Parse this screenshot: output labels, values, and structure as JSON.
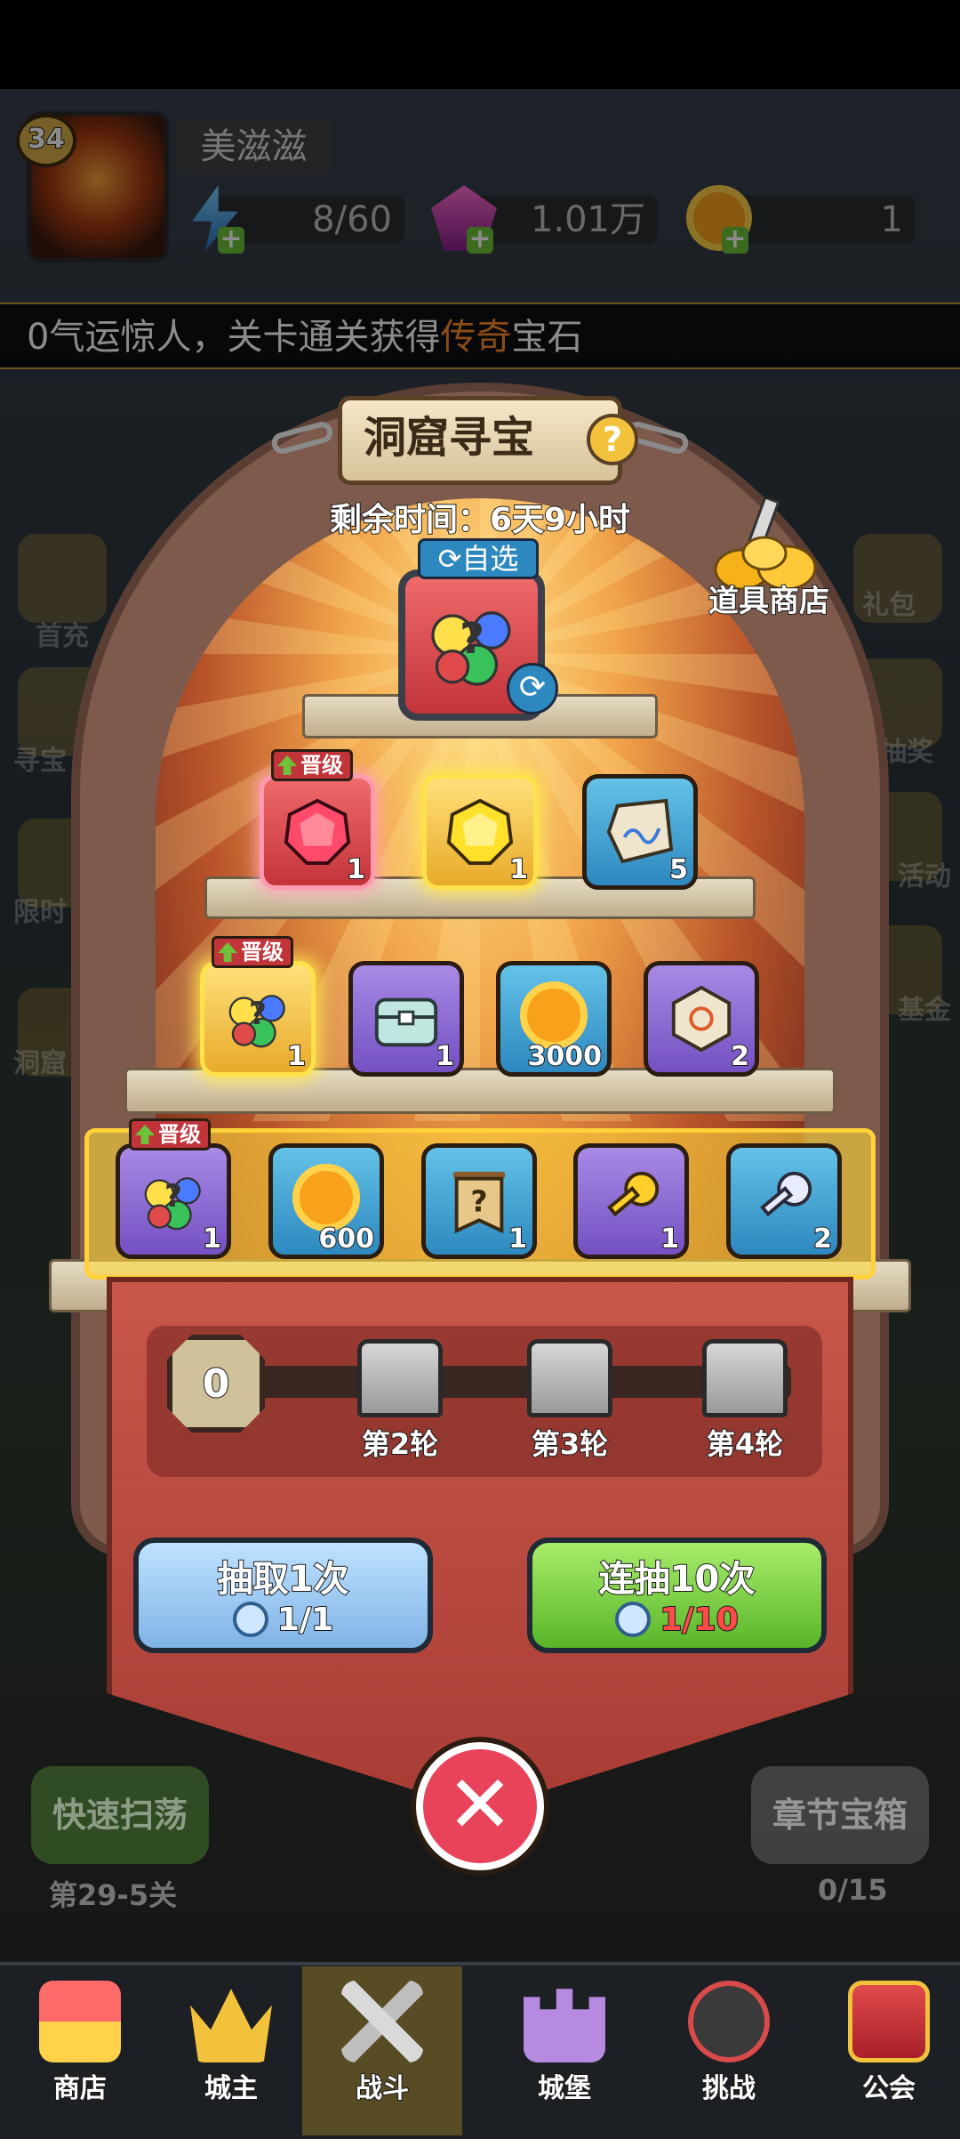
{
  "header": {
    "level": "34",
    "player_name": "美滋滋",
    "energy": "8/60",
    "gems": "1.01万",
    "coins": "1"
  },
  "ticker": {
    "prefix": "0气运惊人，关卡通关获得",
    "highlight": "传奇",
    "suffix": "宝石"
  },
  "side_left": [
    "首充",
    "寻宝",
    "限时",
    "洞窟"
  ],
  "side_right": [
    "礼包",
    "抽奖",
    "活动",
    "基金"
  ],
  "event": {
    "title": "洞窟寻宝",
    "help": "?",
    "remaining": "剩余时间：6天9小时",
    "shop_label": "道具商店",
    "select_label": "自选",
    "upgrade_label": "晋级"
  },
  "pyramid": {
    "row2": [
      {
        "icon": "red-gem-icon",
        "count": "1"
      },
      {
        "icon": "yellow-gem-icon",
        "count": "1"
      },
      {
        "icon": "scroll-stone-icon",
        "count": "5"
      }
    ],
    "row3": [
      {
        "icon": "gem-bundle-icon",
        "count": "1"
      },
      {
        "icon": "treasure-chest-icon",
        "count": "1"
      },
      {
        "icon": "gold-coin-icon",
        "count": "3000"
      },
      {
        "icon": "rune-stone-icon",
        "count": "2"
      }
    ],
    "row4": [
      {
        "icon": "gem-bundle-icon",
        "count": "1"
      },
      {
        "icon": "gold-coin-icon",
        "count": "600"
      },
      {
        "icon": "mystery-scroll-icon",
        "count": "1"
      },
      {
        "icon": "gold-key-icon",
        "count": "1"
      },
      {
        "icon": "silver-key-icon",
        "count": "2"
      }
    ]
  },
  "progress": {
    "value": "0",
    "rounds": [
      "第2轮",
      "第3轮",
      "第4轮"
    ]
  },
  "buttons": {
    "draw1_label": "抽取1次",
    "draw1_cost": "1/1",
    "draw10_label": "连抽10次",
    "draw10_cost": "1/10"
  },
  "background": {
    "sweep_label": "快速扫荡",
    "stage_label": "第29-5关",
    "chapter_label": "章节宝箱",
    "chapter_stars": "0/15"
  },
  "nav": [
    "商店",
    "城主",
    "战斗",
    "城堡",
    "挑战",
    "公会"
  ],
  "colors": {
    "accent": "#ffd23a",
    "highlight_text": "#ff8a2a",
    "banner": "#b84a40"
  }
}
